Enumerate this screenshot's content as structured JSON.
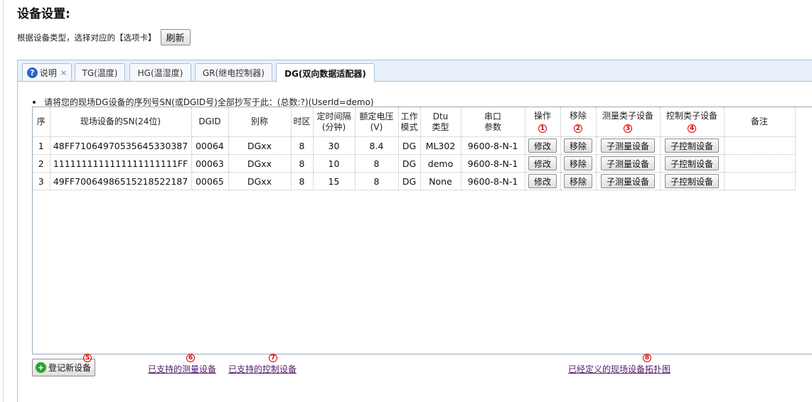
{
  "page": {
    "title": "设备设置:",
    "hint": "根据设备类型，选择对应的【选项卡】",
    "refresh_label": "刷新"
  },
  "tabs": [
    {
      "label": "说明"
    },
    {
      "label": "TG(温度)"
    },
    {
      "label": "HG(温湿度)"
    },
    {
      "label": "GR(继电控制器)"
    },
    {
      "label": "DG(双向数据适配器)"
    }
  ],
  "tab_close": "×",
  "help_glyph": "?",
  "note": "请将您的现场DG设备的序列号SN(或DGID号)全部抄写于此：(总数:?)(UserId=demo)",
  "table": {
    "headers": {
      "seq": "序",
      "sn": "现场设备的SN(24位)",
      "dgid": "DGID",
      "alias": "别称",
      "tz": "时区",
      "interval_1": "定时间隔",
      "interval_2": "(分钟)",
      "voltage_1": "额定电压",
      "voltage_2": "(V)",
      "mode_1": "工作",
      "mode_2": "模式",
      "dtu_1": "Dtu",
      "dtu_2": "类型",
      "serial_1": "串口",
      "serial_2": "参数",
      "op": "操作",
      "remove": "移除",
      "sub_measure": "测量类子设备",
      "sub_control": "控制类子设备",
      "remark": "备注"
    },
    "markers": {
      "op": "1",
      "remove": "2",
      "sub_measure": "3",
      "sub_control": "4"
    },
    "rows": [
      {
        "seq": "1",
        "sn": "48FF71064970535645330387",
        "dgid": "00064",
        "alias": "DGxx",
        "tz": "8",
        "interval": "30",
        "voltage": "8.4",
        "mode": "DG",
        "dtu": "ML302",
        "serial": "9600-8-N-1",
        "remark": ""
      },
      {
        "seq": "2",
        "sn": "1111111111111111111111FF",
        "dgid": "00063",
        "alias": "DGxx",
        "tz": "8",
        "interval": "10",
        "voltage": "8",
        "mode": "DG",
        "dtu": "demo",
        "serial": "9600-8-N-1",
        "remark": ""
      },
      {
        "seq": "3",
        "sn": "49FF70064986515218522187",
        "dgid": "00065",
        "alias": "DGxx",
        "tz": "8",
        "interval": "15",
        "voltage": "8",
        "mode": "DG",
        "dtu": "None",
        "serial": "9600-8-N-1",
        "remark": ""
      }
    ],
    "row_buttons": {
      "edit": "修改",
      "remove": "移除",
      "sub_measure": "子测量设备",
      "sub_control": "子控制设备"
    }
  },
  "footer": {
    "register_label": "登记新设备",
    "register_icon": "+",
    "register_marker": "5",
    "link_measure": "已支持的测量设备",
    "link_measure_marker": "6",
    "link_control": "已支持的控制设备",
    "link_control_marker": "7",
    "link_topology": "已经定义的现场设备拓扑图",
    "link_topology_marker": "8"
  },
  "colors": {
    "marker": "#dd0000",
    "link": "#52186e",
    "tab_border": "#a9c1df"
  }
}
